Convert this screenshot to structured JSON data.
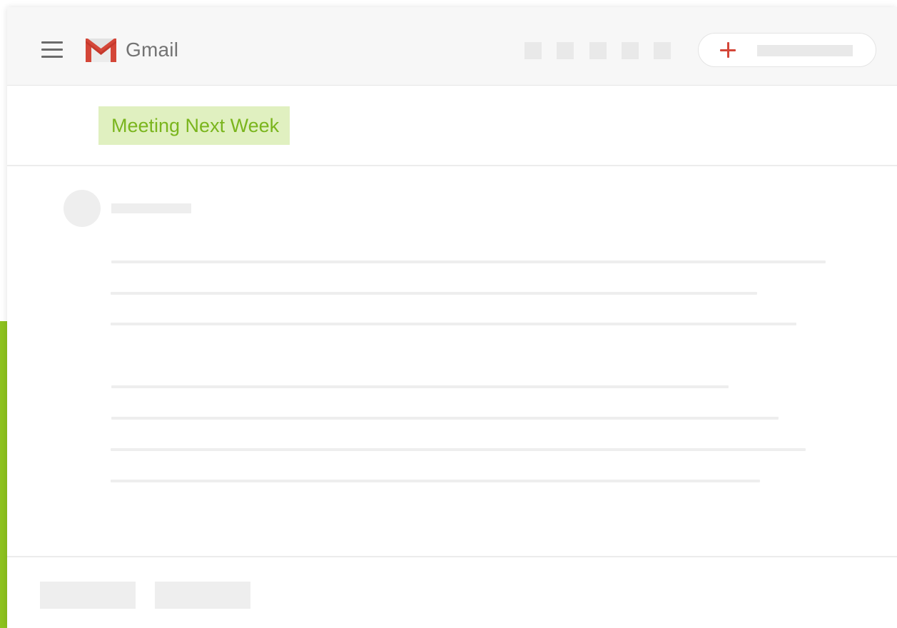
{
  "app": {
    "name": "Gmail"
  },
  "toolbar": {
    "action_icons": [
      "toolbar-action-1",
      "toolbar-action-2",
      "toolbar-action-3",
      "toolbar-action-4",
      "toolbar-action-5"
    ]
  },
  "compose": {
    "icon": "plus-icon"
  },
  "message": {
    "subject": "Meeting Next Week"
  },
  "colors": {
    "accent_green": "#8dc21f",
    "subject_text": "#7ab51d",
    "subject_highlight": "#e0f0c0",
    "gmail_red": "#d44638",
    "placeholder_gray": "#eeeeee"
  }
}
